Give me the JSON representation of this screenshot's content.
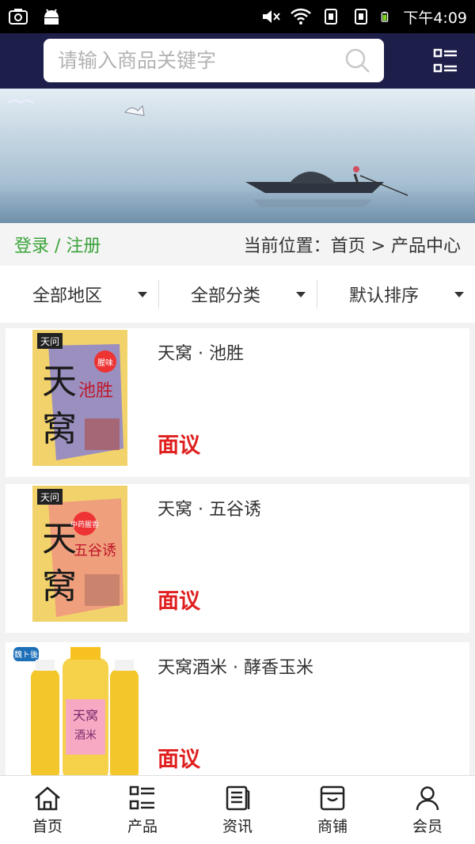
{
  "status_bar": {
    "time": "下午4:09"
  },
  "search": {
    "placeholder": "请输入商品关键字",
    "value": ""
  },
  "breadcrumb_bar": {
    "login_label": "登录 / 注册",
    "location": "当前位置：首页 > 产品中心"
  },
  "filters": [
    {
      "label": "全部地区"
    },
    {
      "label": "全部分类"
    },
    {
      "label": "默认排序"
    }
  ],
  "products": [
    {
      "name": "天窝 · 池胜",
      "price": "面议",
      "package_brand": "天问",
      "package_title": "天窝",
      "package_subtitle": "池胜",
      "package_badge": "腥味"
    },
    {
      "name": "天窝 · 五谷诱",
      "price": "面议",
      "package_brand": "天问",
      "package_title": "天窝",
      "package_subtitle": "五谷诱",
      "package_badge": "中药腥香"
    },
    {
      "name": "天窝酒米 · 酵香玉米",
      "price": "面议",
      "package_brand": "魏ト後",
      "package_title": "天窝",
      "package_subtitle": "酒米"
    }
  ],
  "tabs": [
    {
      "label": "首页",
      "icon": "home-icon"
    },
    {
      "label": "产品",
      "icon": "grid-list-icon"
    },
    {
      "label": "资讯",
      "icon": "news-icon"
    },
    {
      "label": "商铺",
      "icon": "store-icon"
    },
    {
      "label": "会员",
      "icon": "user-icon"
    }
  ],
  "colors": {
    "header_bg": "#1d1f4a",
    "login_green": "#3aa33a",
    "price_red": "#e02020"
  }
}
